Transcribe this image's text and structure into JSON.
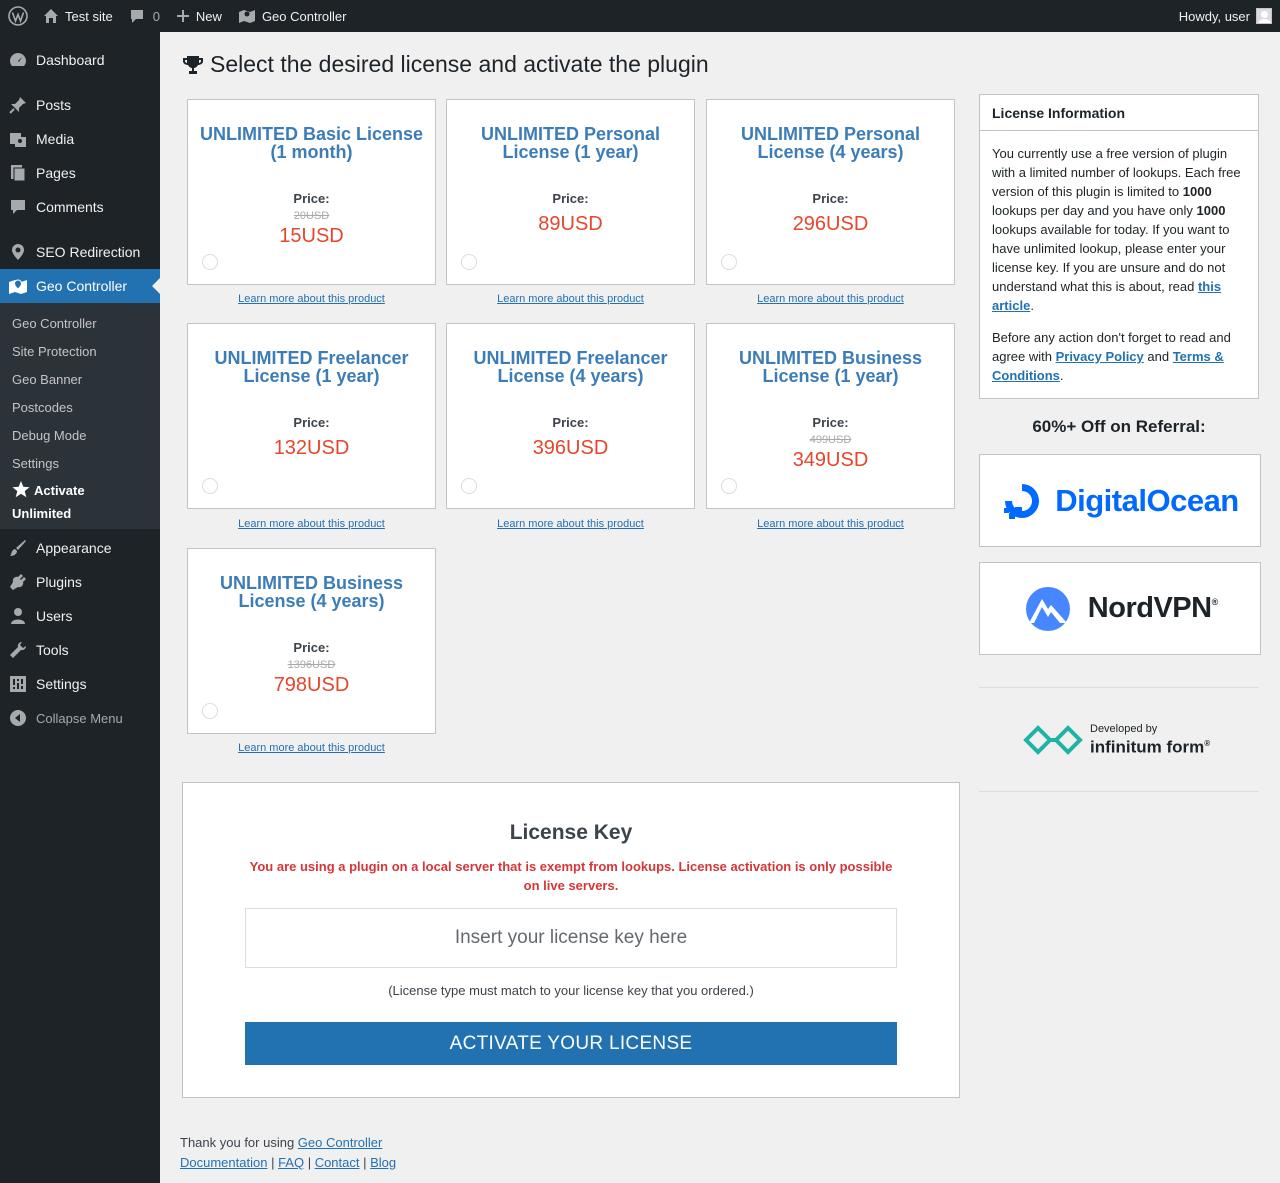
{
  "adminbar": {
    "site_name": "Test site",
    "comments_count": "0",
    "new_label": "New",
    "plugin_label": "Geo Controller",
    "greeting": "Howdy, user"
  },
  "sidebar": {
    "items_top": [
      {
        "label": "Dashboard",
        "icon": "dashboard-icon"
      }
    ],
    "items_mid": [
      {
        "label": "Posts",
        "icon": "pin-icon"
      },
      {
        "label": "Media",
        "icon": "media-icon"
      },
      {
        "label": "Pages",
        "icon": "pages-icon"
      },
      {
        "label": "Comments",
        "icon": "comment-icon"
      }
    ],
    "seo_label": "SEO Redirection",
    "geo_label": "Geo Controller",
    "submenu": [
      "Geo Controller",
      "Site Protection",
      "Geo Banner",
      "Postcodes",
      "Debug Mode",
      "Settings"
    ],
    "submenu_active_line1": "Activate",
    "submenu_active_line2": "Unlimited",
    "items_bottom": [
      {
        "label": "Appearance",
        "icon": "brush-icon"
      },
      {
        "label": "Plugins",
        "icon": "plugin-icon"
      },
      {
        "label": "Users",
        "icon": "user-icon"
      },
      {
        "label": "Tools",
        "icon": "wrench-icon"
      },
      {
        "label": "Settings",
        "icon": "settings-icon"
      }
    ],
    "collapse_label": "Collapse Menu"
  },
  "page_title": "Select the desired license and activate the plugin",
  "price_label": "Price:",
  "learn_more": "Learn more about this product",
  "licenses": [
    {
      "title": "UNLIMITED Basic License (1 month)",
      "old_price": "20USD",
      "price": "15USD"
    },
    {
      "title": "UNLIMITED Personal License (1 year)",
      "old_price": "",
      "price": "89USD"
    },
    {
      "title": "UNLIMITED Personal License (4 years)",
      "old_price": "",
      "price": "296USD"
    },
    {
      "title": "UNLIMITED Freelancer License (1 year)",
      "old_price": "",
      "price": "132USD"
    },
    {
      "title": "UNLIMITED Freelancer License (4 years)",
      "old_price": "",
      "price": "396USD"
    },
    {
      "title": "UNLIMITED Business License (1 year)",
      "old_price": "499USD",
      "price": "349USD"
    },
    {
      "title": "UNLIMITED Business License (4 years)",
      "old_price": "1396USD",
      "price": "798USD"
    }
  ],
  "info": {
    "heading": "License Information",
    "p1_a": "You currently use a free version of plugin with a limited number of lookups. Each free version of this plugin is limited to ",
    "p1_b": "1000",
    "p1_c": " lookups per day and you have only ",
    "p1_d": "1000",
    "p1_e": " lookups available for today. If you want to have unlimited lookup, please enter your license key. If you are unsure and do not understand what this is about, read ",
    "p1_link": "this article",
    "p1_end": ".",
    "p2_a": "Before any action don't forget to read and agree with ",
    "p2_link1": "Privacy Policy",
    "p2_and": " and ",
    "p2_link2": "Terms & Conditions",
    "p2_end": "."
  },
  "referral_title": "60%+ Off on Referral:",
  "sponsors": {
    "digitalocean": "DigitalOcean",
    "nordvpn": "NordVPN",
    "nordvpn_reg": "®"
  },
  "developer": {
    "line1": "Developed by",
    "line2": "infinitum form",
    "reg": "®"
  },
  "license_key": {
    "title": "License Key",
    "warning": "You are using a plugin on a local server that is exempt from lookups. License activation is only possible on live servers.",
    "placeholder": "Insert your license key here",
    "note": "(License type must match to your license key that you ordered.)",
    "button": "ACTIVATE YOUR LICENSE"
  },
  "footer": {
    "thanks": "Thank you for using ",
    "plugin_link": "Geo Controller",
    "links": [
      "Documentation",
      "FAQ",
      "Contact",
      "Blog"
    ],
    "sep": " | "
  },
  "colors": {
    "accent": "#2271b1",
    "price": "#e5462c",
    "title": "#3c7db8",
    "warning": "#d63638"
  }
}
